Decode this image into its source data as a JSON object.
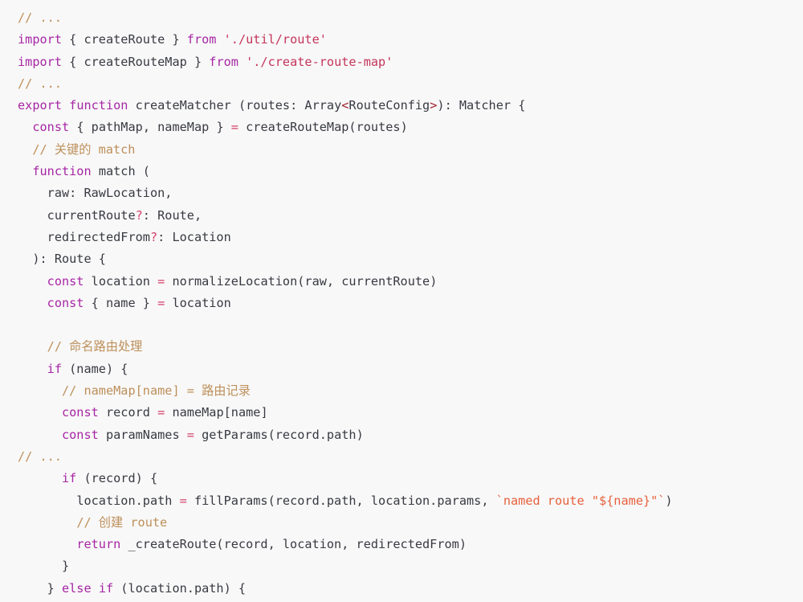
{
  "editor": {
    "background": "#f8f8f8",
    "default_text_color": "#383a42",
    "language": "javascript-flow",
    "colors": {
      "comment": "#bd8f5a",
      "keyword": "#a626a4",
      "function": "#4078f2",
      "variable": "#4078f2",
      "string": "#c4355b",
      "template_string": "#e8603c",
      "operator": "#d4426b",
      "angle_bracket": "#a0222c",
      "plain": "#383a42"
    }
  },
  "code": {
    "lines": [
      {
        "n": 1,
        "indent": 0,
        "tokens": [
          {
            "t": "// ...",
            "c": "comment"
          }
        ]
      },
      {
        "n": 2,
        "indent": 0,
        "tokens": [
          {
            "t": "import",
            "c": "keyword"
          },
          {
            "t": " { ",
            "c": "plain"
          },
          {
            "t": "createRoute",
            "c": "function"
          },
          {
            "t": " } ",
            "c": "plain"
          },
          {
            "t": "from",
            "c": "keyword"
          },
          {
            "t": " ",
            "c": "plain"
          },
          {
            "t": "'./util/route'",
            "c": "string"
          }
        ]
      },
      {
        "n": 3,
        "indent": 0,
        "tokens": [
          {
            "t": "import",
            "c": "keyword"
          },
          {
            "t": " { ",
            "c": "plain"
          },
          {
            "t": "createRouteMap",
            "c": "function"
          },
          {
            "t": " } ",
            "c": "plain"
          },
          {
            "t": "from",
            "c": "keyword"
          },
          {
            "t": " ",
            "c": "plain"
          },
          {
            "t": "'./create-route-map'",
            "c": "string"
          }
        ]
      },
      {
        "n": 4,
        "indent": 0,
        "tokens": [
          {
            "t": "// ...",
            "c": "comment"
          }
        ]
      },
      {
        "n": 5,
        "indent": 0,
        "tokens": [
          {
            "t": "export",
            "c": "keyword"
          },
          {
            "t": " ",
            "c": "plain"
          },
          {
            "t": "function",
            "c": "keyword"
          },
          {
            "t": " ",
            "c": "plain"
          },
          {
            "t": "createMatcher",
            "c": "function"
          },
          {
            "t": " (",
            "c": "plain"
          },
          {
            "t": "routes",
            "c": "variable"
          },
          {
            "t": ": Array",
            "c": "plain"
          },
          {
            "t": "<",
            "c": "angle"
          },
          {
            "t": "RouteConfig",
            "c": "plain"
          },
          {
            "t": ">",
            "c": "angle"
          },
          {
            "t": "): Matcher {",
            "c": "plain"
          }
        ]
      },
      {
        "n": 6,
        "indent": 2,
        "tokens": [
          {
            "t": "const",
            "c": "keyword"
          },
          {
            "t": " { ",
            "c": "plain"
          },
          {
            "t": "pathMap",
            "c": "variable"
          },
          {
            "t": ", ",
            "c": "plain"
          },
          {
            "t": "nameMap",
            "c": "variable"
          },
          {
            "t": " } ",
            "c": "plain"
          },
          {
            "t": "=",
            "c": "operator"
          },
          {
            "t": " createRouteMap(routes)",
            "c": "plain"
          }
        ]
      },
      {
        "n": 7,
        "indent": 2,
        "tokens": [
          {
            "t": "// 关键的 match",
            "c": "comment"
          }
        ]
      },
      {
        "n": 8,
        "indent": 2,
        "tokens": [
          {
            "t": "function",
            "c": "keyword"
          },
          {
            "t": " ",
            "c": "plain"
          },
          {
            "t": "match",
            "c": "function"
          },
          {
            "t": " (",
            "c": "plain"
          }
        ]
      },
      {
        "n": 9,
        "indent": 4,
        "tokens": [
          {
            "t": "raw",
            "c": "variable"
          },
          {
            "t": ": RawLocation,",
            "c": "plain"
          }
        ]
      },
      {
        "n": 10,
        "indent": 4,
        "tokens": [
          {
            "t": "currentRoute",
            "c": "plain"
          },
          {
            "t": "?",
            "c": "optional"
          },
          {
            "t": ": Route,",
            "c": "plain"
          }
        ]
      },
      {
        "n": 11,
        "indent": 4,
        "tokens": [
          {
            "t": "redirectedFrom",
            "c": "plain"
          },
          {
            "t": "?",
            "c": "optional"
          },
          {
            "t": ": Location",
            "c": "plain"
          }
        ]
      },
      {
        "n": 12,
        "indent": 2,
        "tokens": [
          {
            "t": "): Route {",
            "c": "plain"
          }
        ]
      },
      {
        "n": 13,
        "indent": 4,
        "tokens": [
          {
            "t": "const",
            "c": "keyword"
          },
          {
            "t": " ",
            "c": "plain"
          },
          {
            "t": "location",
            "c": "variable"
          },
          {
            "t": " ",
            "c": "plain"
          },
          {
            "t": "=",
            "c": "operator"
          },
          {
            "t": " normalizeLocation(raw, currentRoute)",
            "c": "plain"
          }
        ]
      },
      {
        "n": 14,
        "indent": 4,
        "tokens": [
          {
            "t": "const",
            "c": "keyword"
          },
          {
            "t": " { ",
            "c": "plain"
          },
          {
            "t": "name",
            "c": "variable"
          },
          {
            "t": " } ",
            "c": "plain"
          },
          {
            "t": "=",
            "c": "operator"
          },
          {
            "t": " location",
            "c": "plain"
          }
        ]
      },
      {
        "n": 15,
        "indent": 0,
        "tokens": []
      },
      {
        "n": 16,
        "indent": 4,
        "tokens": [
          {
            "t": "// 命名路由处理",
            "c": "comment"
          }
        ]
      },
      {
        "n": 17,
        "indent": 4,
        "tokens": [
          {
            "t": "if",
            "c": "keyword"
          },
          {
            "t": " (name) {",
            "c": "plain"
          }
        ]
      },
      {
        "n": 18,
        "indent": 6,
        "tokens": [
          {
            "t": "// nameMap[name] = 路由记录",
            "c": "comment"
          }
        ]
      },
      {
        "n": 19,
        "indent": 6,
        "tokens": [
          {
            "t": "const",
            "c": "keyword"
          },
          {
            "t": " ",
            "c": "plain"
          },
          {
            "t": "record",
            "c": "variable"
          },
          {
            "t": " ",
            "c": "plain"
          },
          {
            "t": "=",
            "c": "operator"
          },
          {
            "t": " nameMap[name]",
            "c": "plain"
          }
        ]
      },
      {
        "n": 20,
        "indent": 6,
        "tokens": [
          {
            "t": "const",
            "c": "keyword"
          },
          {
            "t": " ",
            "c": "plain"
          },
          {
            "t": "paramNames",
            "c": "variable"
          },
          {
            "t": " ",
            "c": "plain"
          },
          {
            "t": "=",
            "c": "operator"
          },
          {
            "t": " getParams(record.path)",
            "c": "plain"
          }
        ]
      },
      {
        "n": 21,
        "indent": 0,
        "tokens": [
          {
            "t": "// ...",
            "c": "comment"
          }
        ]
      },
      {
        "n": 22,
        "indent": 6,
        "tokens": [
          {
            "t": "if",
            "c": "keyword"
          },
          {
            "t": " (record) {",
            "c": "plain"
          }
        ]
      },
      {
        "n": 23,
        "indent": 8,
        "tokens": [
          {
            "t": "location.path ",
            "c": "plain"
          },
          {
            "t": "=",
            "c": "operator"
          },
          {
            "t": " fillParams(record.path, location.params, ",
            "c": "plain"
          },
          {
            "t": "`named route \"${name}\"`",
            "c": "template"
          },
          {
            "t": ")",
            "c": "plain"
          }
        ]
      },
      {
        "n": 24,
        "indent": 8,
        "tokens": [
          {
            "t": "// 创建 route",
            "c": "comment"
          }
        ]
      },
      {
        "n": 25,
        "indent": 8,
        "tokens": [
          {
            "t": "return",
            "c": "keyword"
          },
          {
            "t": " _createRoute(record, location, redirectedFrom)",
            "c": "plain"
          }
        ]
      },
      {
        "n": 26,
        "indent": 6,
        "tokens": [
          {
            "t": "}",
            "c": "plain"
          }
        ]
      },
      {
        "n": 27,
        "indent": 4,
        "tokens": [
          {
            "t": "} ",
            "c": "plain"
          },
          {
            "t": "else",
            "c": "keyword"
          },
          {
            "t": " ",
            "c": "plain"
          },
          {
            "t": "if",
            "c": "keyword"
          },
          {
            "t": " (location.path) {",
            "c": "plain"
          }
        ]
      }
    ]
  }
}
